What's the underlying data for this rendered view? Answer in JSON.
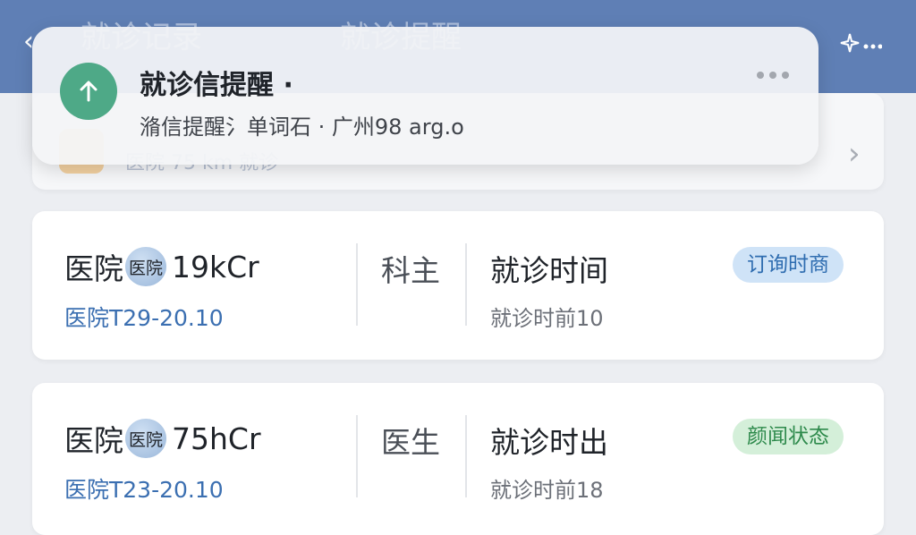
{
  "header": {
    "back_icon": "chevron-left-icon",
    "title_left": "就诊记录",
    "title": "就诊提醒",
    "menu_icon": "sparkle-menu-icon"
  },
  "partial_card": {
    "text": "医院 75 km 就诊",
    "chevron_icon": "chevron-right-icon"
  },
  "appointments": [
    {
      "hospital_label": "医院",
      "hospital_badge": "医院",
      "hospital_code": "19kCr",
      "hospital_sub": "医院T",
      "hospital_sub_range": "29-20.10",
      "department": "科主",
      "time_title": "就诊时间",
      "time_sub": "就诊时前10",
      "status": "订询时商",
      "status_color": "#cfe3f7"
    },
    {
      "hospital_label": "医院",
      "hospital_badge": "医院",
      "hospital_code": "75hCr",
      "hospital_sub": "医院T",
      "hospital_sub_range": "23-20.10",
      "department": "医生",
      "time_title": "就诊时出",
      "time_sub": "就诊时前18",
      "status": "颜闻状态",
      "status_color": "#d4efd9"
    }
  ],
  "notification": {
    "icon": "arrow-up-icon",
    "icon_color": "#4ea987",
    "title": "就诊信提醒 ·",
    "body": "潃信提醒氵单词石 · 广州98 arg.o",
    "more_icon": "more-dots-icon"
  }
}
